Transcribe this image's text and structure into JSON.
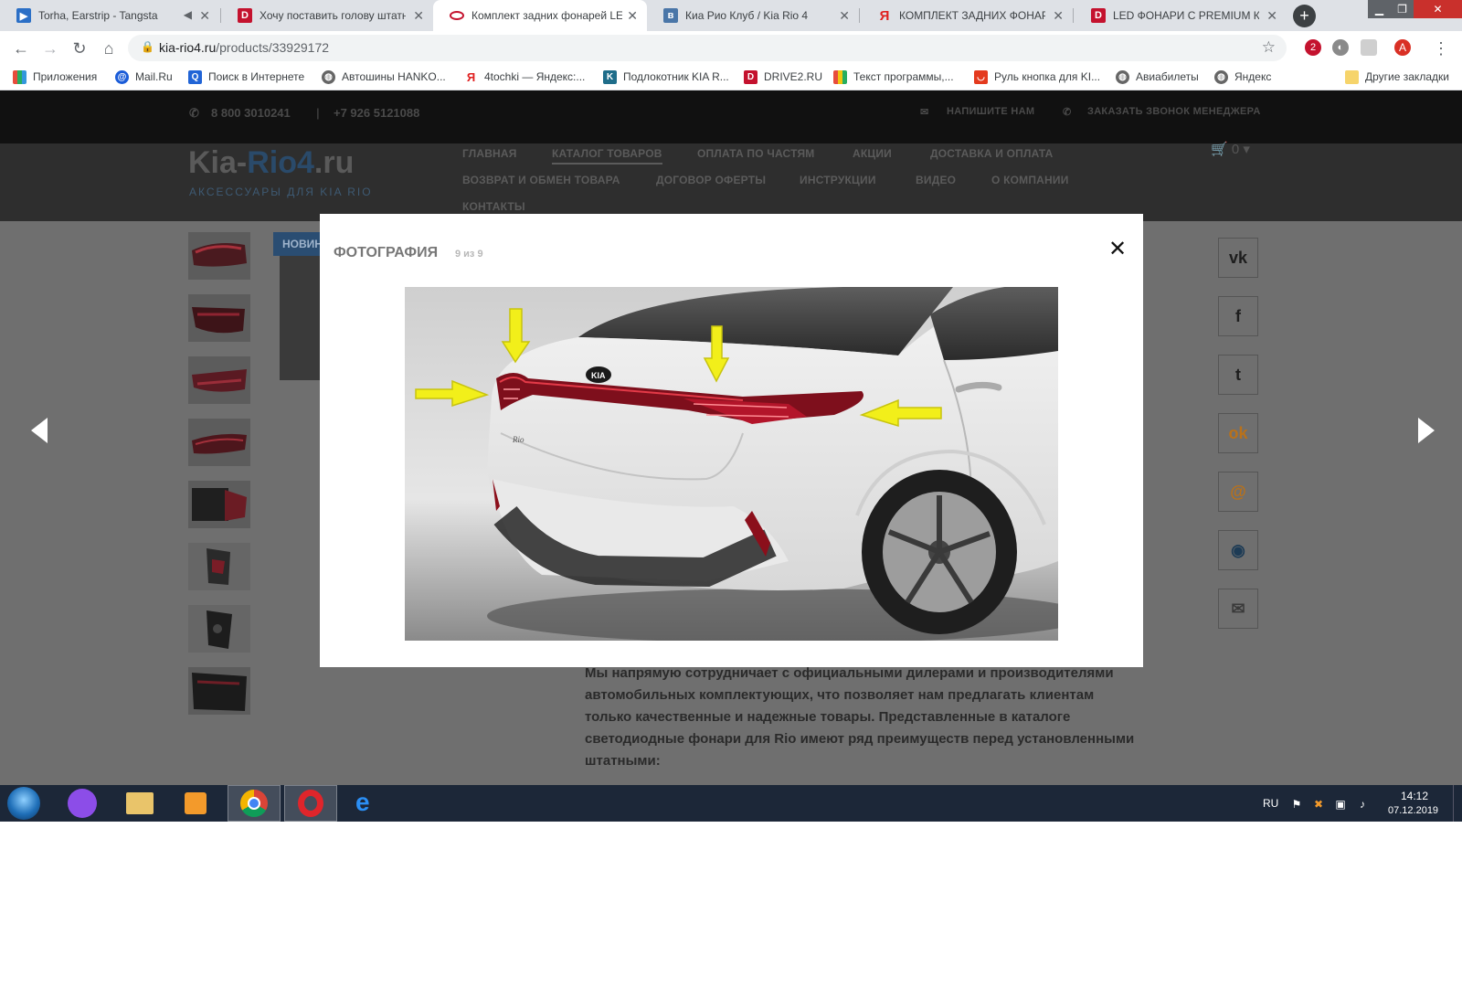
{
  "browser": {
    "tabs": [
      {
        "title": "Torha, Earstrip - Tangsta",
        "icon": "play-icon"
      },
      {
        "title": "Хочу поставить голову штатну",
        "icon": "drive2-icon"
      },
      {
        "title": "Комплект задних фонарей LED",
        "icon": "kia-icon"
      },
      {
        "title": "Киа Рио Клуб / Kia Rio 4",
        "icon": "vk-icon"
      },
      {
        "title": "КОМПЛЕКТ ЗАДНИХ ФОНАРЕЙ",
        "icon": "yandex-icon"
      },
      {
        "title": "LED ФОНАРИ С PREMIUM КОМ",
        "icon": "drive2-icon"
      }
    ],
    "new_tab": "+",
    "url_host": "kia-rio4.ru",
    "url_path": "/products/33929172",
    "profile_letter": "A",
    "ext_badge": "2",
    "bookmarks": [
      {
        "label": "Приложения",
        "icon": "apps-icon"
      },
      {
        "label": "Mail.Ru",
        "icon": "mailru-icon"
      },
      {
        "label": "Поиск в Интернете",
        "icon": "search-icon"
      },
      {
        "label": "Автошины HANKO...",
        "icon": "globe-icon"
      },
      {
        "label": "4tochki — Яндекс:...",
        "icon": "yandex-icon"
      },
      {
        "label": "Подлокотник KIA R...",
        "icon": "k-icon"
      },
      {
        "label": "DRIVE2.RU",
        "icon": "drive2-icon"
      },
      {
        "label": "Текст программы,...",
        "icon": "bars-icon"
      },
      {
        "label": "Руль кнопка для KI...",
        "icon": "aliexpress-icon"
      },
      {
        "label": "Авиабилеты",
        "icon": "globe-icon"
      },
      {
        "label": "Яндекс",
        "icon": "globe-icon"
      }
    ],
    "other_bookmarks": "Другие закладки"
  },
  "site": {
    "phone1": "8 800 3010241",
    "phone2": "+7 926 5121088",
    "write_us": "НАПИШИТЕ НАМ",
    "call_manager": "ЗАКАЗАТЬ ЗВОНОК МЕНЕДЖЕРА",
    "logo_part1": "Kia-",
    "logo_part2": "Rio4",
    "logo_part3": ".ru",
    "slogan": "АКСЕССУАРЫ ДЛЯ KIA RIO",
    "menu": [
      "ГЛАВНАЯ",
      "КАТАЛОГ ТОВАРОВ",
      "ОПЛАТА ПО ЧАСТЯМ",
      "АКЦИИ",
      "ДОСТАВКА И ОПЛАТА",
      "ВОЗВРАТ И ОБМЕН ТОВАРА",
      "ДОГОВОР ОФЕРТЫ",
      "ИНСТРУКЦИИ",
      "ВИДЕО",
      "О КОМПАНИИ",
      "КОНТАКТЫ"
    ],
    "cart_count": "0",
    "novelty_badge": "НОВИН",
    "share_buttons": [
      "vk-icon",
      "facebook-icon",
      "twitter-icon",
      "odnoklassniki-icon",
      "mailru-icon",
      "livejournal-icon",
      "email-icon"
    ],
    "description_lines": [
      "Мы напрямую сотрудничает с официальными дилерами и производителями",
      "автомобильных комплектующих, что позволяет нам предлагать клиентам",
      "только качественные и надежные товары. Представленные в каталоге",
      "светодиодные фонари для Rio имеют ряд преимуществ перед установленными",
      "штатными:"
    ]
  },
  "modal": {
    "title": "ФОТОГРАФИЯ",
    "counter": "9 из 9",
    "close_symbol": "✕"
  },
  "taskbar": {
    "lang": "RU",
    "time": "14:12",
    "date": "07.12.2019"
  },
  "colors": {
    "accent_yellow": "#f5d21a",
    "arrow_yellow": "#f2ef1a",
    "taillight_red": "#b3152a"
  }
}
